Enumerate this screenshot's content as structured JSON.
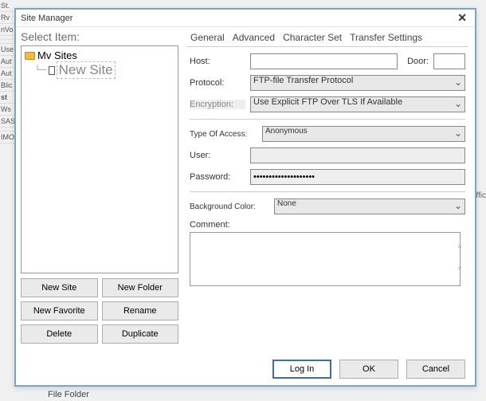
{
  "bg": {
    "items": [
      "St.",
      "Rv",
      "nVo",
      "",
      "",
      "Use",
      "Aut",
      "Aut",
      "Blic",
      "st",
      "Ws",
      "SAS",
      "",
      "IMO"
    ],
    "bottom": "File Folder",
    "right": "ffic"
  },
  "title": "Site Manager",
  "select_label": "Select Item:",
  "tree": {
    "root": "Mv Sites",
    "child": "New Site"
  },
  "buttons": {
    "new_site": "New Site",
    "new_folder": "New Folder",
    "new_fav": "New Favorite",
    "rename": "Rename",
    "delete": "Delete",
    "duplicate": "Duplicate"
  },
  "tabs": [
    "General",
    "Advanced",
    "Character Set",
    "Transfer Settings"
  ],
  "form": {
    "host_lbl": "Host:",
    "host_val": "",
    "door_lbl": "Door:",
    "door_val": "",
    "proto_lbl": "Protocol:",
    "proto_val": "FTP-file Transfer Protocol",
    "enc_lbl": "Encryption:",
    "enc_val": "Use Explicit FTP Over TLS If Available",
    "access_lbl": "Type Of Access:",
    "access_val": "Anonymous",
    "user_lbl": "User:",
    "user_val": "",
    "pass_lbl": "Password:",
    "pass_val": "••••••••••••••••••••",
    "bgcolor_lbl": "Background Color:",
    "bgcolor_val": "None",
    "comment_lbl": "Comment:",
    "comment_val": ""
  },
  "bottom": {
    "login": "Log In",
    "ok": "OK",
    "cancel": "Cancel"
  }
}
